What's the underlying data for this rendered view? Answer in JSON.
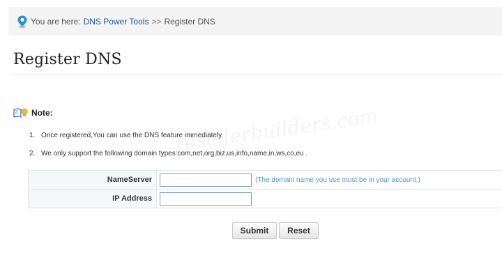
{
  "breadcrumb": {
    "prefix": "You are here:",
    "link": "DNS Power Tools",
    "separator": ">>",
    "current": "Register DNS",
    "icon": "location-pin-icon"
  },
  "page_title": "Register DNS",
  "note": {
    "heading": "Note:",
    "icon": "book-lightbulb-icon",
    "items": [
      {
        "num": "1.",
        "text": "Once registered,You can use the DNS feature immediately."
      },
      {
        "num": "2.",
        "text": "We only support the following domain types:com,net,org,biz,us,info,name,in,ws,co,eu ."
      }
    ]
  },
  "watermark": "resellerbuilders.com",
  "form": {
    "nameserver_label": "NameServer",
    "nameserver_value": "",
    "nameserver_hint": "(The domain name you use must be in your account.)",
    "ip_label": "IP Address",
    "ip_value": ""
  },
  "buttons": {
    "submit": "Submit",
    "reset": "Reset"
  },
  "colors": {
    "link": "#1a5aa8",
    "hint": "#4d97c9",
    "breadcrumb_bg": "#f4f4f4",
    "pin": "#2b8fd6"
  }
}
